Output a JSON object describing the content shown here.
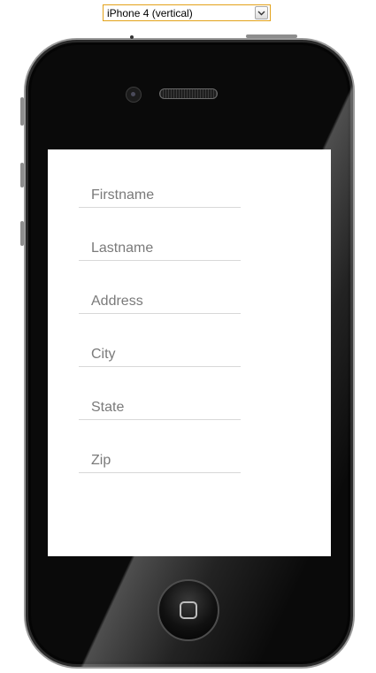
{
  "device_select": {
    "selected": "iPhone 4 (vertical)"
  },
  "form": {
    "fields": [
      {
        "placeholder": "Firstname",
        "value": ""
      },
      {
        "placeholder": "Lastname",
        "value": ""
      },
      {
        "placeholder": "Address",
        "value": ""
      },
      {
        "placeholder": "City",
        "value": ""
      },
      {
        "placeholder": "State",
        "value": ""
      },
      {
        "placeholder": "Zip",
        "value": ""
      }
    ]
  },
  "colors": {
    "select_border": "#e3a21a",
    "phone_body": "#0a0a0a",
    "screen_background": "#ffffff",
    "field_underline": "#d8d8d8",
    "placeholder_text": "#7a7a7a"
  },
  "icons": {
    "select_arrow": "chevron-down-icon",
    "home": "home-square-icon"
  }
}
